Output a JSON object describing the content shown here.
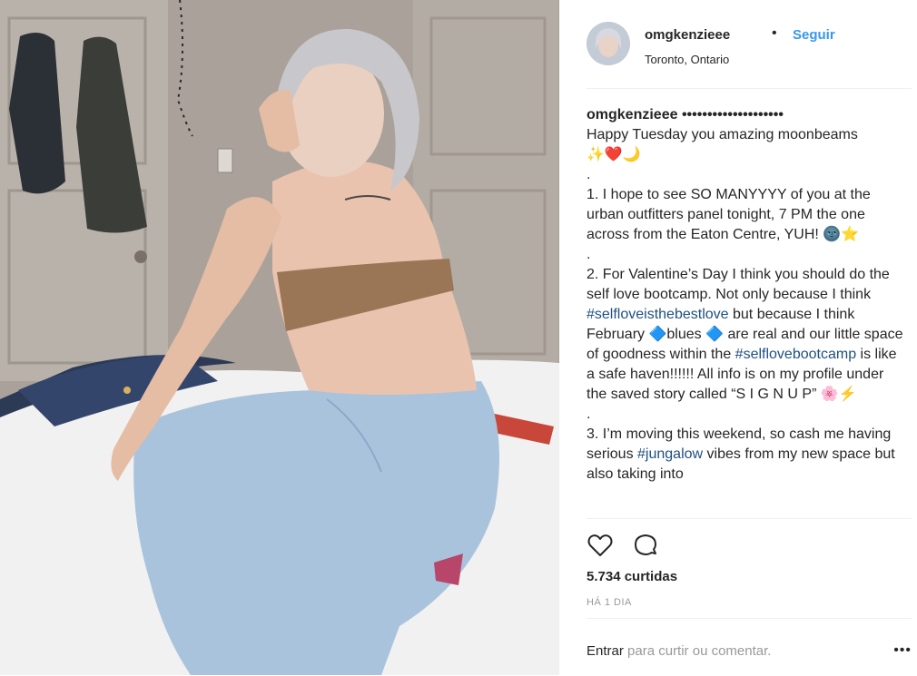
{
  "post": {
    "username": "omgkenzieee",
    "separator": "•",
    "follow_label": "Seguir",
    "location": "Toronto, Ontario",
    "caption_username": "omgkenzieee",
    "caption_dots": "••••••••••••••••••••",
    "caption": {
      "line_greeting": "Happy Tuesday you amazing moonbeams",
      "greeting_emojis": "✨❤️🌙",
      "dot1": ".",
      "p1": "1. I hope to see SO MANYYYY of you at the urban outfitters panel tonight, 7 PM the one across from the Eaton Centre, YUH!",
      "p1_emojis": "🌚⭐",
      "dot2": ".",
      "p2_a": "2. For Valentine’s Day I think you should do the self love bootcamp. Not only because I think",
      "p2_tag1": "#selfloveisthebestlove",
      "p2_b": "but because I think February",
      "p2_emoji1": "🔷",
      "p2_c": "blues",
      "p2_emoji2": "🔷",
      "p2_d": "are real and our little space of goodness within the",
      "p2_tag2": "#selflovebootcamp",
      "p2_e": "is like a safe haven!!!!!! All info is on my profile under the saved story called “S I G N U P”",
      "p2_emojis": "🌸⚡",
      "dot3": ".",
      "p3_a": "3. I’m moving this weekend, so cash me having serious",
      "p3_tag": "#jungalow",
      "p3_b": "vibes from my new space but also taking into"
    },
    "likes": "5.734 curtidas",
    "time": "HÁ 1 DIA",
    "login_link": "Entrar",
    "login_rest": "para curtir ou comentar.",
    "more_label": "•••",
    "icons": {
      "like": "heart-icon",
      "comment": "comment-icon"
    }
  }
}
